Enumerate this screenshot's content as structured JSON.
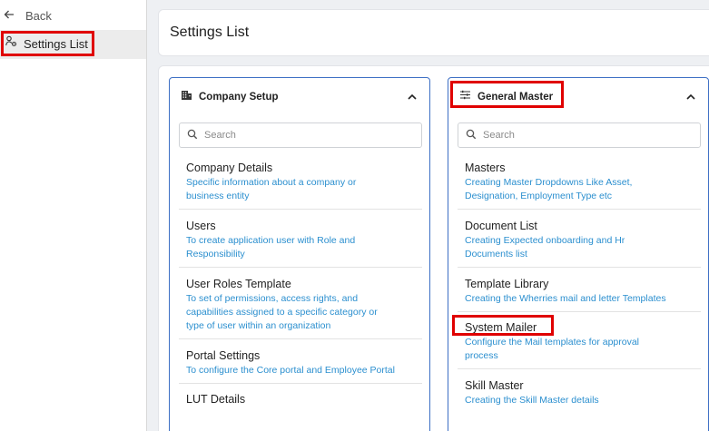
{
  "sidebar": {
    "back_label": "Back",
    "nav_items": [
      {
        "label": "Settings List"
      }
    ]
  },
  "header": {
    "title": "Settings List"
  },
  "panels": [
    {
      "title": "Company Setup",
      "search_placeholder": "Search",
      "items": [
        {
          "title": "Company Details",
          "desc": [
            "Specific information about a company or",
            "business entity"
          ]
        },
        {
          "title": "Users",
          "desc": [
            "To create application user with Role and",
            "Responsibility"
          ]
        },
        {
          "title": "User Roles Template",
          "desc": [
            "To set of permissions, access rights, and",
            "capabilities assigned to a specific category or",
            "type of user within an organization"
          ]
        },
        {
          "title": "Portal Settings",
          "desc": [
            "To configure the Core portal and Employee Portal"
          ]
        },
        {
          "title": "LUT Details",
          "desc": []
        }
      ]
    },
    {
      "title": "General Master",
      "search_placeholder": "Search",
      "items": [
        {
          "title": "Masters",
          "desc": [
            "Creating Master Dropdowns Like Asset,",
            "Designation, Employment Type etc"
          ]
        },
        {
          "title": "Document List",
          "desc": [
            "Creating Expected onboarding and Hr",
            "Documents list"
          ]
        },
        {
          "title": "Template Library",
          "desc": [
            "Creating the Wherries mail and letter Templates"
          ]
        },
        {
          "title": "System Mailer",
          "desc": [
            "Configure the Mail templates for approval",
            "process"
          ]
        },
        {
          "title": "Skill Master",
          "desc": [
            "Creating the Skill Master details"
          ]
        }
      ]
    }
  ],
  "colors": {
    "highlight": "#e00000",
    "panel_border": "#3d6fc4",
    "link_text": "#2b8fcf"
  }
}
